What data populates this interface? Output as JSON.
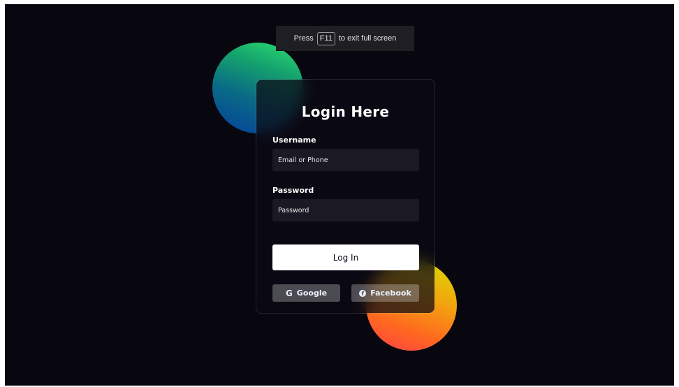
{
  "fullscreen_notice": {
    "before": "Press",
    "key": "F11",
    "after": "to exit full screen"
  },
  "form": {
    "title": "Login Here",
    "username_label": "Username",
    "username_placeholder": "Email or Phone",
    "password_label": "Password",
    "password_placeholder": "Password",
    "login_button": "Log In",
    "google_icon": "G",
    "google_label": "Google",
    "facebook_icon": "f",
    "facebook_label": "Facebook"
  },
  "colors": {
    "background": "#080710",
    "button_bg": "#ffffff",
    "shape_green": "#23d05d",
    "shape_orange": "#ff512f"
  },
  "icons": {
    "google": "google-icon",
    "facebook": "facebook-icon"
  }
}
